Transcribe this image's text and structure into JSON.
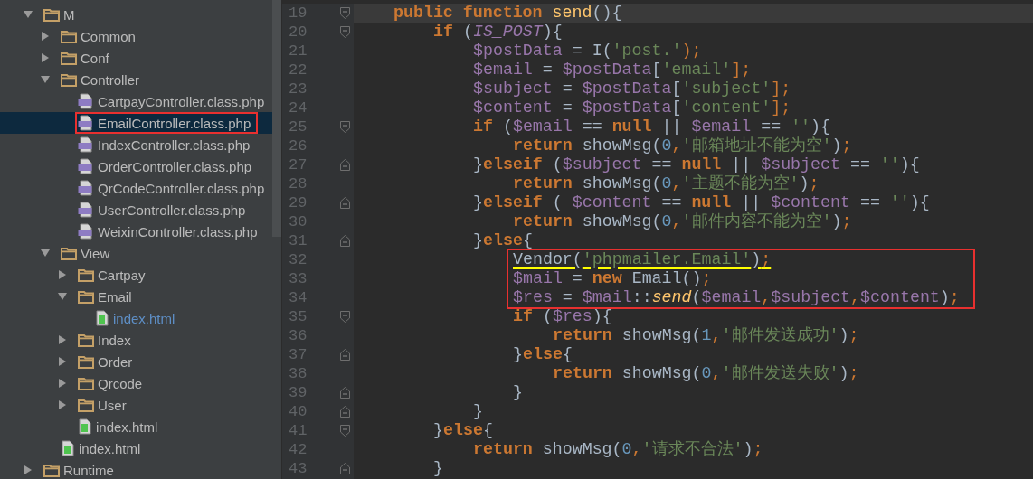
{
  "tree": [
    {
      "kind": "folder",
      "name": "M",
      "expanded": true,
      "selected": false,
      "boxed": false,
      "changed": false,
      "children": [
        {
          "kind": "folder",
          "name": "Common",
          "expanded": false,
          "selected": false,
          "boxed": false,
          "changed": false
        },
        {
          "kind": "folder",
          "name": "Conf",
          "expanded": false,
          "selected": false,
          "boxed": false,
          "changed": false
        },
        {
          "kind": "folder",
          "name": "Controller",
          "expanded": true,
          "selected": false,
          "boxed": false,
          "changed": false,
          "children": [
            {
              "kind": "php",
              "name": "CartpayController.class.php",
              "selected": false,
              "boxed": false,
              "changed": false
            },
            {
              "kind": "php",
              "name": "EmailController.class.php",
              "selected": true,
              "boxed": true,
              "changed": false
            },
            {
              "kind": "php",
              "name": "IndexController.class.php",
              "selected": false,
              "boxed": false,
              "changed": false
            },
            {
              "kind": "php",
              "name": "OrderController.class.php",
              "selected": false,
              "boxed": false,
              "changed": false
            },
            {
              "kind": "php",
              "name": "QrCodeController.class.php",
              "selected": false,
              "boxed": false,
              "changed": false
            },
            {
              "kind": "php",
              "name": "UserController.class.php",
              "selected": false,
              "boxed": false,
              "changed": false
            },
            {
              "kind": "php",
              "name": "WeixinController.class.php",
              "selected": false,
              "boxed": false,
              "changed": false
            }
          ]
        },
        {
          "kind": "folder",
          "name": "View",
          "expanded": true,
          "selected": false,
          "boxed": false,
          "changed": false,
          "children": [
            {
              "kind": "folder",
              "name": "Cartpay",
              "expanded": false,
              "selected": false,
              "boxed": false,
              "changed": false
            },
            {
              "kind": "folder",
              "name": "Email",
              "expanded": true,
              "selected": false,
              "boxed": false,
              "changed": false,
              "children": [
                {
                  "kind": "html",
                  "name": "index.html",
                  "selected": false,
                  "boxed": false,
                  "changed": true
                }
              ]
            },
            {
              "kind": "folder",
              "name": "Index",
              "expanded": false,
              "selected": false,
              "boxed": false,
              "changed": false
            },
            {
              "kind": "folder",
              "name": "Order",
              "expanded": false,
              "selected": false,
              "boxed": false,
              "changed": false
            },
            {
              "kind": "folder",
              "name": "Qrcode",
              "expanded": false,
              "selected": false,
              "boxed": false,
              "changed": false
            },
            {
              "kind": "folder",
              "name": "User",
              "expanded": false,
              "selected": false,
              "boxed": false,
              "changed": false
            },
            {
              "kind": "html",
              "name": "index.html",
              "selected": false,
              "boxed": false,
              "changed": false
            }
          ]
        },
        {
          "kind": "html",
          "name": "index.html",
          "selected": false,
          "boxed": false,
          "changed": false
        }
      ]
    },
    {
      "kind": "folder",
      "name": "Runtime",
      "expanded": false,
      "selected": false,
      "boxed": false,
      "changed": false
    }
  ],
  "editor": {
    "lines": [
      {
        "kind": "line",
        "number": "19",
        "fold_start": true,
        "fold_end": false,
        "current": true,
        "underlined": false,
        "tokens": [
          {
            "t": "public",
            "kind": "k"
          },
          {
            "t": " function",
            "kind": "k"
          },
          {
            "t": " send",
            "kind": "f"
          },
          {
            "t": "(){",
            "kind": "p"
          }
        ],
        "children": [
          {
            "kind": "line",
            "number": "20",
            "fold_start": true,
            "fold_end": false,
            "current": false,
            "underlined": false,
            "tokens": [
              {
                "t": "if",
                "kind": "k"
              },
              {
                "t": " (",
                "kind": "p"
              },
              {
                "t": "IS_POST",
                "kind": "c"
              },
              {
                "t": "){",
                "kind": "p"
              }
            ],
            "children": [
              {
                "kind": "line",
                "number": "21",
                "fold_start": false,
                "fold_end": false,
                "current": false,
                "underlined": false,
                "tokens": [
                  {
                    "t": "$postData",
                    "kind": "v"
                  },
                  {
                    "t": " = I(",
                    "kind": "p"
                  },
                  {
                    "t": "'post.'",
                    "kind": "s"
                  },
                  {
                    "t": ");",
                    "kind": "o"
                  }
                ]
              },
              {
                "kind": "line",
                "number": "22",
                "fold_start": false,
                "fold_end": false,
                "current": false,
                "underlined": false,
                "tokens": [
                  {
                    "t": "$email",
                    "kind": "v"
                  },
                  {
                    "t": " = ",
                    "kind": "p"
                  },
                  {
                    "t": "$postData",
                    "kind": "v"
                  },
                  {
                    "t": "[",
                    "kind": "p"
                  },
                  {
                    "t": "'email'",
                    "kind": "s"
                  },
                  {
                    "t": "];",
                    "kind": "o"
                  }
                ]
              },
              {
                "kind": "line",
                "number": "23",
                "fold_start": false,
                "fold_end": false,
                "current": false,
                "underlined": false,
                "tokens": [
                  {
                    "t": "$subject",
                    "kind": "v"
                  },
                  {
                    "t": " = ",
                    "kind": "p"
                  },
                  {
                    "t": "$postData",
                    "kind": "v"
                  },
                  {
                    "t": "[",
                    "kind": "p"
                  },
                  {
                    "t": "'subject'",
                    "kind": "s"
                  },
                  {
                    "t": "];",
                    "kind": "o"
                  }
                ]
              },
              {
                "kind": "line",
                "number": "24",
                "fold_start": false,
                "fold_end": false,
                "current": false,
                "underlined": false,
                "tokens": [
                  {
                    "t": "$content",
                    "kind": "v"
                  },
                  {
                    "t": " = ",
                    "kind": "p"
                  },
                  {
                    "t": "$postData",
                    "kind": "v"
                  },
                  {
                    "t": "[",
                    "kind": "p"
                  },
                  {
                    "t": "'content'",
                    "kind": "s"
                  },
                  {
                    "t": "];",
                    "kind": "o"
                  }
                ]
              },
              {
                "kind": "line",
                "number": "25",
                "fold_start": true,
                "fold_end": false,
                "current": false,
                "underlined": false,
                "tokens": [
                  {
                    "t": "if",
                    "kind": "k"
                  },
                  {
                    "t": " (",
                    "kind": "p"
                  },
                  {
                    "t": "$email",
                    "kind": "v"
                  },
                  {
                    "t": " == ",
                    "kind": "p"
                  },
                  {
                    "t": "null",
                    "kind": "k"
                  },
                  {
                    "t": " || ",
                    "kind": "p"
                  },
                  {
                    "t": "$email",
                    "kind": "v"
                  },
                  {
                    "t": " == ",
                    "kind": "p"
                  },
                  {
                    "t": "''",
                    "kind": "s"
                  },
                  {
                    "t": "){",
                    "kind": "p"
                  }
                ],
                "children": [
                  {
                    "kind": "line",
                    "number": "26",
                    "fold_start": false,
                    "fold_end": false,
                    "current": false,
                    "underlined": false,
                    "tokens": [
                      {
                        "t": "return",
                        "kind": "k"
                      },
                      {
                        "t": " showMsg(",
                        "kind": "p"
                      },
                      {
                        "t": "0",
                        "kind": "n"
                      },
                      {
                        "t": ",",
                        "kind": "o"
                      },
                      {
                        "t": "'邮箱地址不能为空'",
                        "kind": "s"
                      },
                      {
                        "t": ")",
                        "kind": "p"
                      },
                      {
                        "t": ";",
                        "kind": "o"
                      }
                    ]
                  }
                ]
              },
              {
                "kind": "line",
                "number": "27",
                "fold_start": false,
                "fold_end": true,
                "current": false,
                "underlined": false,
                "tokens": [
                  {
                    "t": "}",
                    "kind": "p"
                  },
                  {
                    "t": "elseif",
                    "kind": "k"
                  },
                  {
                    "t": " (",
                    "kind": "p"
                  },
                  {
                    "t": "$subject",
                    "kind": "v"
                  },
                  {
                    "t": " == ",
                    "kind": "p"
                  },
                  {
                    "t": "null",
                    "kind": "k"
                  },
                  {
                    "t": " || ",
                    "kind": "p"
                  },
                  {
                    "t": "$subject",
                    "kind": "v"
                  },
                  {
                    "t": " == ",
                    "kind": "p"
                  },
                  {
                    "t": "''",
                    "kind": "s"
                  },
                  {
                    "t": "){",
                    "kind": "p"
                  }
                ],
                "children": [
                  {
                    "kind": "line",
                    "number": "28",
                    "fold_start": false,
                    "fold_end": false,
                    "current": false,
                    "underlined": false,
                    "tokens": [
                      {
                        "t": "return",
                        "kind": "k"
                      },
                      {
                        "t": " showMsg(",
                        "kind": "p"
                      },
                      {
                        "t": "0",
                        "kind": "n"
                      },
                      {
                        "t": ",",
                        "kind": "o"
                      },
                      {
                        "t": "'主题不能为空'",
                        "kind": "s"
                      },
                      {
                        "t": ")",
                        "kind": "p"
                      },
                      {
                        "t": ";",
                        "kind": "o"
                      }
                    ]
                  }
                ]
              },
              {
                "kind": "line",
                "number": "29",
                "fold_start": false,
                "fold_end": true,
                "current": false,
                "underlined": false,
                "tokens": [
                  {
                    "t": "}",
                    "kind": "p"
                  },
                  {
                    "t": "elseif",
                    "kind": "k"
                  },
                  {
                    "t": " ( ",
                    "kind": "p"
                  },
                  {
                    "t": "$content",
                    "kind": "v"
                  },
                  {
                    "t": " == ",
                    "kind": "p"
                  },
                  {
                    "t": "null",
                    "kind": "k"
                  },
                  {
                    "t": " || ",
                    "kind": "p"
                  },
                  {
                    "t": "$content",
                    "kind": "v"
                  },
                  {
                    "t": " == ",
                    "kind": "p"
                  },
                  {
                    "t": "''",
                    "kind": "s"
                  },
                  {
                    "t": "){",
                    "kind": "p"
                  }
                ],
                "children": [
                  {
                    "kind": "line",
                    "number": "30",
                    "fold_start": false,
                    "fold_end": false,
                    "current": false,
                    "underlined": false,
                    "tokens": [
                      {
                        "t": "return",
                        "kind": "k"
                      },
                      {
                        "t": " showMsg(",
                        "kind": "p"
                      },
                      {
                        "t": "0",
                        "kind": "n"
                      },
                      {
                        "t": ",",
                        "kind": "o"
                      },
                      {
                        "t": "'邮件内容不能为空'",
                        "kind": "s"
                      },
                      {
                        "t": ")",
                        "kind": "p"
                      },
                      {
                        "t": ";",
                        "kind": "o"
                      }
                    ]
                  }
                ]
              },
              {
                "kind": "line",
                "number": "31",
                "fold_start": false,
                "fold_end": true,
                "current": false,
                "underlined": false,
                "tokens": [
                  {
                    "t": "}",
                    "kind": "p"
                  },
                  {
                    "t": "else",
                    "kind": "k"
                  },
                  {
                    "t": "{",
                    "kind": "p"
                  }
                ],
                "children": [
                  {
                    "kind": "box",
                    "lines": [
                      {
                        "kind": "line",
                        "number": "32",
                        "fold_start": false,
                        "fold_end": false,
                        "current": false,
                        "underlined": true,
                        "tokens": [
                          {
                            "t": "Vendor(",
                            "kind": "p"
                          },
                          {
                            "t": "'phpmailer.Email'",
                            "kind": "s"
                          },
                          {
                            "t": ")",
                            "kind": "p"
                          },
                          {
                            "t": ";",
                            "kind": "o"
                          }
                        ]
                      },
                      {
                        "kind": "line",
                        "number": "33",
                        "fold_start": false,
                        "fold_end": false,
                        "current": false,
                        "underlined": false,
                        "tokens": [
                          {
                            "t": "$mail",
                            "kind": "v"
                          },
                          {
                            "t": " = ",
                            "kind": "p"
                          },
                          {
                            "t": "new",
                            "kind": "k"
                          },
                          {
                            "t": " Email()",
                            "kind": "p"
                          },
                          {
                            "t": ";",
                            "kind": "o"
                          }
                        ]
                      },
                      {
                        "kind": "line",
                        "number": "34",
                        "fold_start": false,
                        "fold_end": false,
                        "current": false,
                        "underlined": false,
                        "tokens": [
                          {
                            "t": "$res",
                            "kind": "v"
                          },
                          {
                            "t": " = ",
                            "kind": "p"
                          },
                          {
                            "t": "$mail",
                            "kind": "v"
                          },
                          {
                            "t": "::",
                            "kind": "p"
                          },
                          {
                            "t": "send",
                            "kind": "m"
                          },
                          {
                            "t": "(",
                            "kind": "p"
                          },
                          {
                            "t": "$email",
                            "kind": "v"
                          },
                          {
                            "t": ",",
                            "kind": "o"
                          },
                          {
                            "t": "$subject",
                            "kind": "v"
                          },
                          {
                            "t": ",",
                            "kind": "o"
                          },
                          {
                            "t": "$content",
                            "kind": "v"
                          },
                          {
                            "t": ")",
                            "kind": "p"
                          },
                          {
                            "t": ";",
                            "kind": "o"
                          }
                        ]
                      }
                    ]
                  },
                  {
                    "kind": "line",
                    "number": "35",
                    "fold_start": true,
                    "fold_end": false,
                    "current": false,
                    "underlined": false,
                    "tokens": [
                      {
                        "t": "if",
                        "kind": "k"
                      },
                      {
                        "t": " (",
                        "kind": "p"
                      },
                      {
                        "t": "$res",
                        "kind": "v"
                      },
                      {
                        "t": "){",
                        "kind": "p"
                      }
                    ],
                    "children": [
                      {
                        "kind": "line",
                        "number": "36",
                        "fold_start": false,
                        "fold_end": false,
                        "current": false,
                        "underlined": false,
                        "tokens": [
                          {
                            "t": "return",
                            "kind": "k"
                          },
                          {
                            "t": " showMsg(",
                            "kind": "p"
                          },
                          {
                            "t": "1",
                            "kind": "n"
                          },
                          {
                            "t": ",",
                            "kind": "o"
                          },
                          {
                            "t": "'邮件发送成功'",
                            "kind": "s"
                          },
                          {
                            "t": ")",
                            "kind": "p"
                          },
                          {
                            "t": ";",
                            "kind": "o"
                          }
                        ]
                      }
                    ]
                  },
                  {
                    "kind": "line",
                    "number": "37",
                    "fold_start": false,
                    "fold_end": true,
                    "current": false,
                    "underlined": false,
                    "tokens": [
                      {
                        "t": "}",
                        "kind": "p"
                      },
                      {
                        "t": "else",
                        "kind": "k"
                      },
                      {
                        "t": "{",
                        "kind": "p"
                      }
                    ],
                    "children": [
                      {
                        "kind": "line",
                        "number": "38",
                        "fold_start": false,
                        "fold_end": false,
                        "current": false,
                        "underlined": false,
                        "tokens": [
                          {
                            "t": "return",
                            "kind": "k"
                          },
                          {
                            "t": " showMsg(",
                            "kind": "p"
                          },
                          {
                            "t": "0",
                            "kind": "n"
                          },
                          {
                            "t": ",",
                            "kind": "o"
                          },
                          {
                            "t": "'邮件发送失败'",
                            "kind": "s"
                          },
                          {
                            "t": ")",
                            "kind": "p"
                          },
                          {
                            "t": ";",
                            "kind": "o"
                          }
                        ]
                      }
                    ]
                  },
                  {
                    "kind": "line",
                    "number": "39",
                    "fold_start": false,
                    "fold_end": true,
                    "current": false,
                    "underlined": false,
                    "tokens": [
                      {
                        "t": "}",
                        "kind": "p"
                      }
                    ]
                  }
                ]
              },
              {
                "kind": "line",
                "number": "40",
                "fold_start": false,
                "fold_end": true,
                "current": false,
                "underlined": false,
                "tokens": [
                  {
                    "t": "}",
                    "kind": "p"
                  }
                ]
              }
            ]
          },
          {
            "kind": "line",
            "number": "41",
            "fold_start": true,
            "fold_end": false,
            "current": false,
            "underlined": false,
            "tokens": [
              {
                "t": "}",
                "kind": "p"
              },
              {
                "t": "else",
                "kind": "k"
              },
              {
                "t": "{",
                "kind": "p"
              }
            ],
            "children": [
              {
                "kind": "line",
                "number": "42",
                "fold_start": false,
                "fold_end": false,
                "current": false,
                "underlined": false,
                "tokens": [
                  {
                    "t": "return",
                    "kind": "k"
                  },
                  {
                    "t": " showMsg(",
                    "kind": "p"
                  },
                  {
                    "t": "0",
                    "kind": "n"
                  },
                  {
                    "t": ",",
                    "kind": "o"
                  },
                  {
                    "t": "'请求不合法'",
                    "kind": "s"
                  },
                  {
                    "t": ")",
                    "kind": "p"
                  },
                  {
                    "t": ";",
                    "kind": "o"
                  }
                ]
              }
            ]
          },
          {
            "kind": "line",
            "number": "43",
            "fold_start": false,
            "fold_end": true,
            "current": false,
            "underlined": false,
            "tokens": [
              {
                "t": "}",
                "kind": "p"
              }
            ]
          }
        ]
      }
    ]
  }
}
